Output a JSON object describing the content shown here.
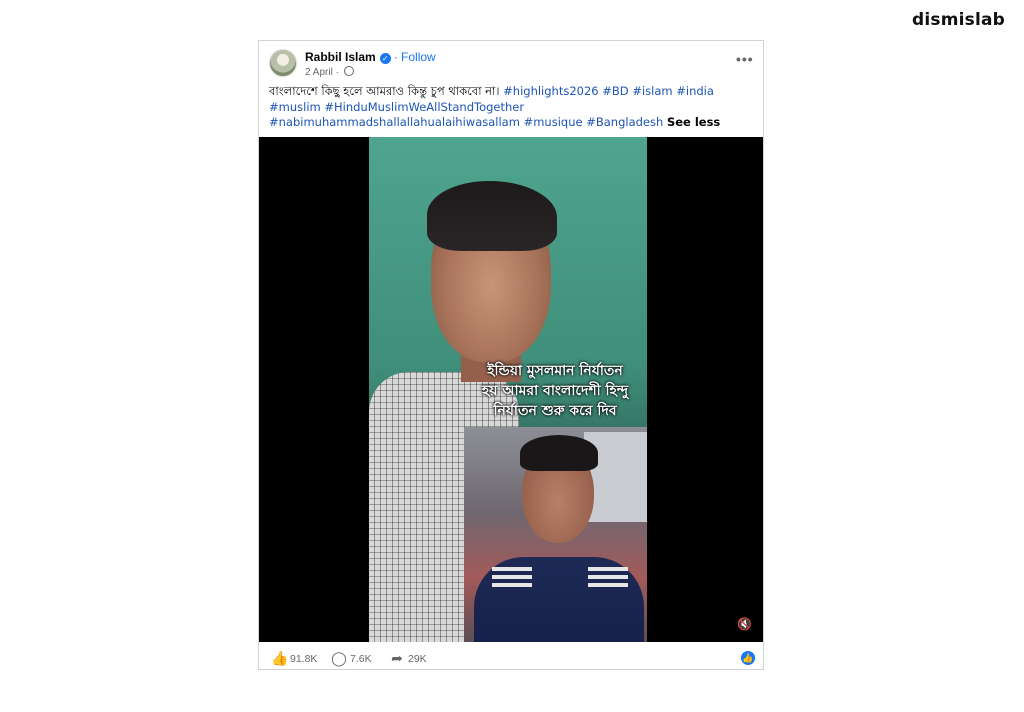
{
  "watermark": {
    "text": "dismislab"
  },
  "post": {
    "author": "Rabbil Islam",
    "verified_icon": "verified-badge-icon",
    "separator": "·",
    "follow_label": "Follow",
    "date": "2 April",
    "date_separator": "·",
    "audience_icon": "globe-icon",
    "more_label": "•••",
    "caption": {
      "text": "বাংলাদেশে কিছু হলে আমরাও কিন্তু চুপ থাকবো না।",
      "hashtags": [
        "#highlights2026",
        "#BD",
        "#islam",
        "#india",
        "#muslim",
        "#HinduMuslimWeAllStandTogether",
        "#nabimuhammadshallallahualaihiwasallam",
        "#musique",
        "#Bangladesh"
      ],
      "see_less": "See less"
    },
    "video": {
      "overlay_lines": [
        "ইন্ডিয়া মুসলমান নির্যাতন",
        "হয় আমরা বাংলাদেশী হিন্দু",
        "নির্যাতন শুরু করে দিব"
      ],
      "mute_icon": "speaker-muted-icon"
    },
    "stats": {
      "reactions": "91.8K",
      "comments": "7.6K",
      "shares": "29K"
    },
    "colors": {
      "link": "#1d55b4",
      "brand": "#1877f2"
    }
  }
}
